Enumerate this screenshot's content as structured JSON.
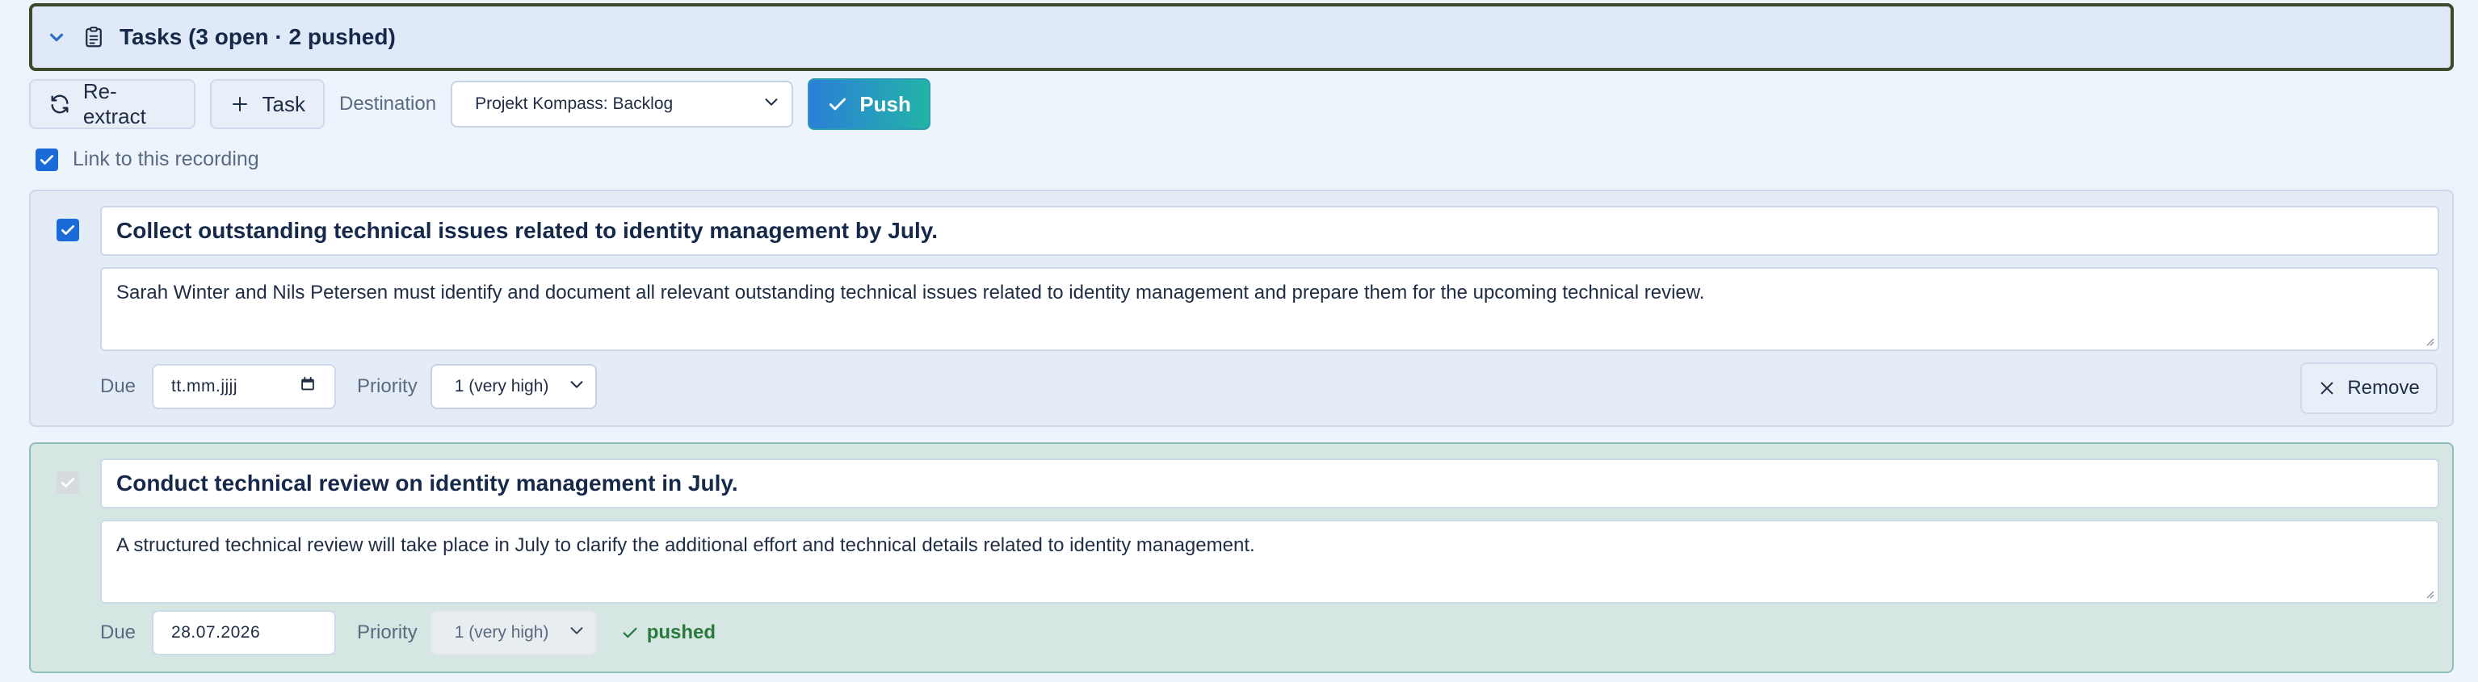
{
  "header": {
    "title": "Tasks (3 open · 2 pushed)",
    "collapse_icon": "chevron-down-icon",
    "title_icon": "clipboard-icon"
  },
  "toolbar": {
    "reextract_label": "Re-extract",
    "add_task_label": "Task",
    "destination_label": "Destination",
    "destination_value": "Projekt Kompass: Backlog",
    "push_label": "Push"
  },
  "link_recording": {
    "label": "Link to this recording",
    "checked": true
  },
  "tasks": [
    {
      "title": "Collect outstanding technical issues related to identity management by July.",
      "description": "Sarah Winter and Nils Petersen must identify and document all relevant outstanding technical issues related to identity management and prepare them for the upcoming technical review.",
      "due_label": "Due",
      "due_value": "tt.mm.jjjj",
      "priority_label": "Priority",
      "priority_value": "1 (very high)",
      "remove_label": "Remove",
      "selected": true,
      "pushed": false
    },
    {
      "title": "Conduct technical review on identity management in July.",
      "description": "A structured technical review will take place in July to clarify the additional effort and technical details related to identity management.",
      "due_label": "Due",
      "due_value": "28.07.2026",
      "priority_label": "Priority",
      "priority_value": "1 (very high)",
      "status": "pushed",
      "selected": true,
      "pushed": true
    }
  ],
  "colors": {
    "accent": "#1a6ad8",
    "push_gradient_start": "#2b7fd8",
    "push_gradient_end": "#22b4a6",
    "pushed_green": "#2a7a3e",
    "pushed_card_bg": "#d5e6e3"
  }
}
